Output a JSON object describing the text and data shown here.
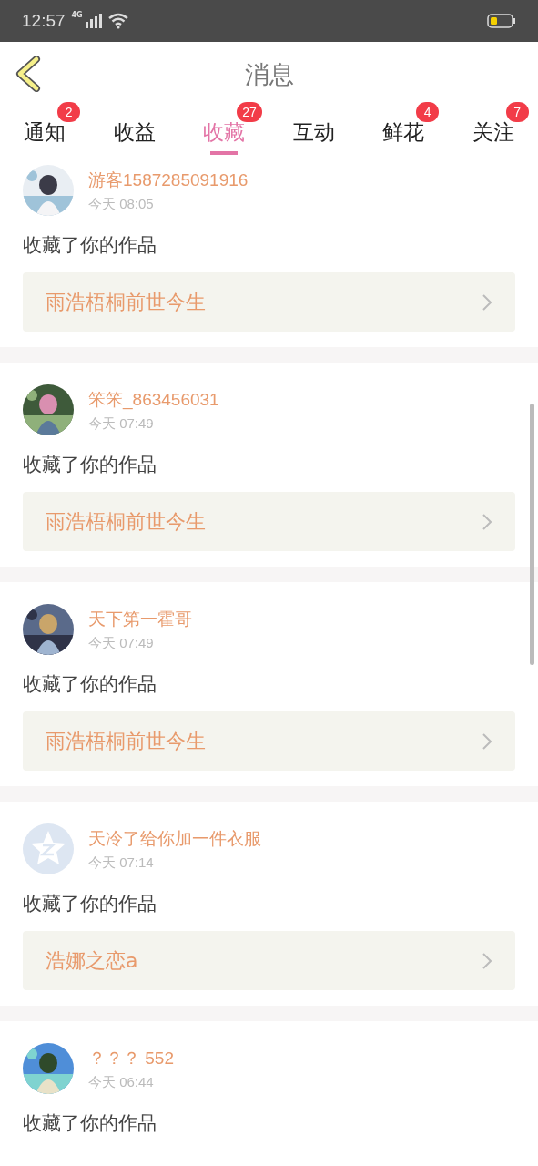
{
  "status_bar": {
    "time": "12:57",
    "network": "4G"
  },
  "header": {
    "title": "消息"
  },
  "tabs": [
    {
      "label": "通知",
      "selected": false,
      "badge": "2"
    },
    {
      "label": "收益",
      "selected": false
    },
    {
      "label": "收藏",
      "selected": true,
      "badge": "27"
    },
    {
      "label": "互动",
      "selected": false
    },
    {
      "label": "鲜花",
      "selected": false,
      "badge": "4"
    },
    {
      "label": "关注",
      "selected": false,
      "badge": "7"
    }
  ],
  "messages": [
    {
      "user": "游客1587285091916",
      "time": "今天 08:05",
      "text": "收藏了你的作品",
      "work": "雨浩梧桐前世今生"
    },
    {
      "user": "笨笨_863456031",
      "time": "今天 07:49",
      "text": "收藏了你的作品",
      "work": "雨浩梧桐前世今生"
    },
    {
      "user": "天下第一霍哥",
      "time": "今天 07:49",
      "text": "收藏了你的作品",
      "work": "雨浩梧桐前世今生"
    },
    {
      "avatar": {
        "kind": "icon"
      },
      "user": "天冷了给你加一件衣服",
      "time": "今天 07:14",
      "text": "收藏了你的作品",
      "work": "浩娜之恋a"
    },
    {
      "user": "？？？ 552",
      "time": "今天 06:44",
      "text": "收藏了你的作品"
    }
  ]
}
